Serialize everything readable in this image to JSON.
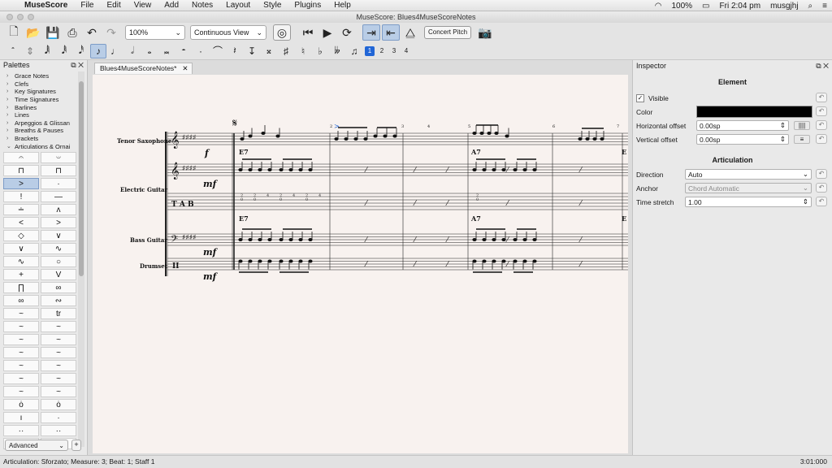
{
  "menubar": {
    "app_name": "MuseScore",
    "items": [
      "File",
      "Edit",
      "View",
      "Add",
      "Notes",
      "Layout",
      "Style",
      "Plugins",
      "Help"
    ],
    "battery": "100%",
    "clock": "Fri 2:04 pm",
    "user": "musgjhj"
  },
  "window": {
    "title": "MuseScore: Blues4MuseScoreNotes"
  },
  "toolbar": {
    "zoom": "100%",
    "view_mode": "Continuous View",
    "concert_pitch": "Concert Pitch"
  },
  "voices": [
    "1",
    "2",
    "3",
    "4"
  ],
  "palettes": {
    "title": "Palettes",
    "items": [
      "Grace Notes",
      "Clefs",
      "Key Signatures",
      "Time Signatures",
      "Barlines",
      "Lines",
      "Arpeggios & Glissan",
      "Breaths & Pauses",
      "Brackets",
      "Articulations & Ornai"
    ],
    "cells": [
      "𝄐",
      "𝄑",
      "⊓",
      "⊓",
      ">",
      "·",
      "!",
      "—",
      "∸",
      "ʌ",
      "<",
      ">",
      "◇",
      "∨",
      "∨",
      "∿",
      "∿",
      "○",
      "+",
      "V",
      "∏",
      "∞",
      "∞",
      "∾",
      "~",
      "tr",
      "~",
      "~",
      "~",
      "~",
      "~",
      "~",
      "~",
      "~",
      "~",
      "~",
      "~",
      "~",
      "ȯ",
      "ȯ",
      "ı",
      "·",
      "··",
      "··",
      "full",
      "⌄"
    ],
    "highlighted_index": 4,
    "workspace": "Advanced"
  },
  "score": {
    "tab_title": "Blues4MuseScoreNotes*",
    "instruments": [
      "Tenor Saxophone",
      "Electric Guitar",
      "Bass Guitar",
      "Drumset"
    ],
    "chords": [
      "E7",
      "A7",
      "E"
    ],
    "dynamics": [
      "f",
      "mf",
      "mf",
      "mf"
    ],
    "measure_numbers": [
      "2",
      "3",
      "4",
      "5",
      "6",
      "7"
    ],
    "tab_numbers": [
      "2",
      "0",
      "2",
      "0",
      "4",
      "2",
      "0",
      "4",
      "2",
      "0",
      "4",
      "2",
      "0"
    ]
  },
  "inspector": {
    "title": "Inspector",
    "element_title": "Element",
    "visible_label": "Visible",
    "color_label": "Color",
    "h_offset_label": "Horizontal offset",
    "h_offset": "0.00sp",
    "v_offset_label": "Vertical offset",
    "v_offset": "0.00sp",
    "artic_title": "Articulation",
    "direction_label": "Direction",
    "direction": "Auto",
    "anchor_label": "Anchor",
    "anchor": "Chord Automatic",
    "time_stretch_label": "Time stretch",
    "time_stretch": "1.00",
    "color_value": "#000000"
  },
  "status": {
    "text": "Articulation: Sforzato;  Measure: 3; Beat: 1; Staff 1",
    "time": "3:01:000"
  }
}
